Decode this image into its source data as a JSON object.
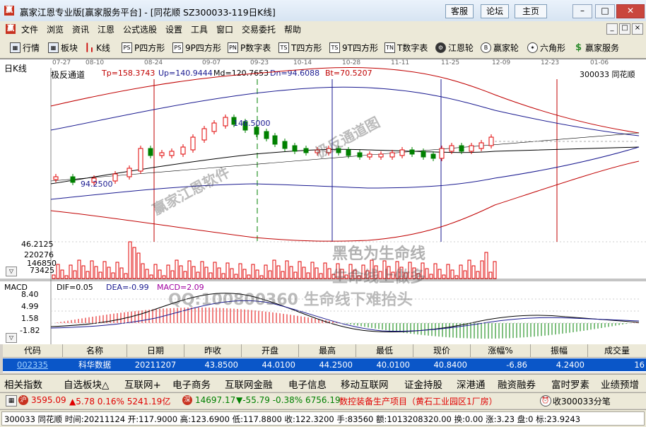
{
  "window": {
    "title": "赢家江恩专业版[赢家服务平台] - [同花顺  SZ300033-119日K线]",
    "app_icon": "赢",
    "buttons": [
      "客服",
      "论坛",
      "主页"
    ],
    "controls": [
      "minimize-icon",
      "maximize-icon",
      "close-icon"
    ]
  },
  "menubar": {
    "items": [
      "文件",
      "浏览",
      "资讯",
      "江恩",
      "公式选股",
      "设置",
      "工具",
      "窗口",
      "交易委托",
      "帮助"
    ]
  },
  "toolbar": {
    "items": [
      {
        "icon": "grid",
        "label": "行情"
      },
      {
        "icon": "grid",
        "label": "板块"
      },
      {
        "icon": "candles",
        "label": "K线"
      },
      {
        "icon": "PS",
        "label": "P四方形"
      },
      {
        "icon": "PS",
        "label": "9P四方形"
      },
      {
        "icon": "PN",
        "label": "P数字表"
      },
      {
        "icon": "TS",
        "label": "T四方形"
      },
      {
        "icon": "TS",
        "label": "9T四方形"
      },
      {
        "icon": "TN",
        "label": "T数字表"
      },
      {
        "icon": "gear",
        "label": "江恩轮"
      },
      {
        "icon": "Big",
        "label": "赢家轮"
      },
      {
        "icon": "star",
        "label": "六角形"
      },
      {
        "icon": "$",
        "label": "赢家服务"
      }
    ]
  },
  "chart": {
    "panel_title": "日K线",
    "indicator": {
      "name": "极反通道",
      "tp": "Tp=158.3743",
      "up": "Up=140.9444",
      "md": "Md=120.7653",
      "dn": "Dn=94.6088",
      "bt": "Bt=70.5207"
    },
    "stock_label": "300033  同花顺",
    "dates": [
      "07-27",
      "08-10",
      "08-24",
      "09-07",
      "09-23",
      "10-14",
      "10-28",
      "11-11",
      "11-25",
      "12-09",
      "12-23",
      "01-06"
    ],
    "price_high_label": "146.5000",
    "price_low_label": "94.2500",
    "low_left_label": "46.2125",
    "volume_ticks": [
      "220276",
      "146850",
      "73425"
    ],
    "macd": {
      "title": "MACD",
      "dif": "DIF=0.05",
      "dea": "DEA=-0.99",
      "macd": "MACD=2.09",
      "ticks": [
        "8.40",
        "4.99",
        "1.58",
        "-1.82"
      ]
    },
    "watermarks": [
      "赢家江恩软件",
      "极反通道图",
      "黑色为生命线",
      "生命线上做多",
      "QQ:100800360  生命线下难抬头"
    ],
    "colors": {
      "up": "#e00000",
      "down": "#008000",
      "grid": "#d0d0d0"
    }
  },
  "table": {
    "headers": [
      "代码",
      "名称",
      "日期",
      "昨收",
      "开盘",
      "最高",
      "最低",
      "现价",
      "涨幅%",
      "振幅",
      "成交量"
    ],
    "row": [
      "002335",
      "科华数据",
      "20211207",
      "43.8500",
      "44.0100",
      "44.2500",
      "40.0100",
      "40.8400",
      "-6.86",
      "4.2400",
      "16"
    ]
  },
  "sector_bar": {
    "items": [
      "相关指数",
      "自选板块△",
      "互联网+",
      "电子商务",
      "互联网金融",
      "电子信息",
      "移动互联网",
      "证金持股",
      "深港通",
      "融资融券",
      "富时罗素",
      "业绩预增"
    ]
  },
  "index_bar": {
    "sh": "3595.09",
    "sh_chg": "▲5.78 0.16% 5241.19亿",
    "sz": "14697.17",
    "sz_chg": "▼-55.79 -0.38% 6756.19",
    "news": "数控装备生产项目（黄石工业园区1厂房）",
    "alert": "收300033分笔"
  },
  "status_bar": {
    "text": "300033 同花顺 时间:20211124 开:117.9000 高:123.6900 低:117.8800 收:122.3200 手:83560 额:1013208320.00 换:0.00 涨:3.23 盘:0 标:23.9243"
  }
}
